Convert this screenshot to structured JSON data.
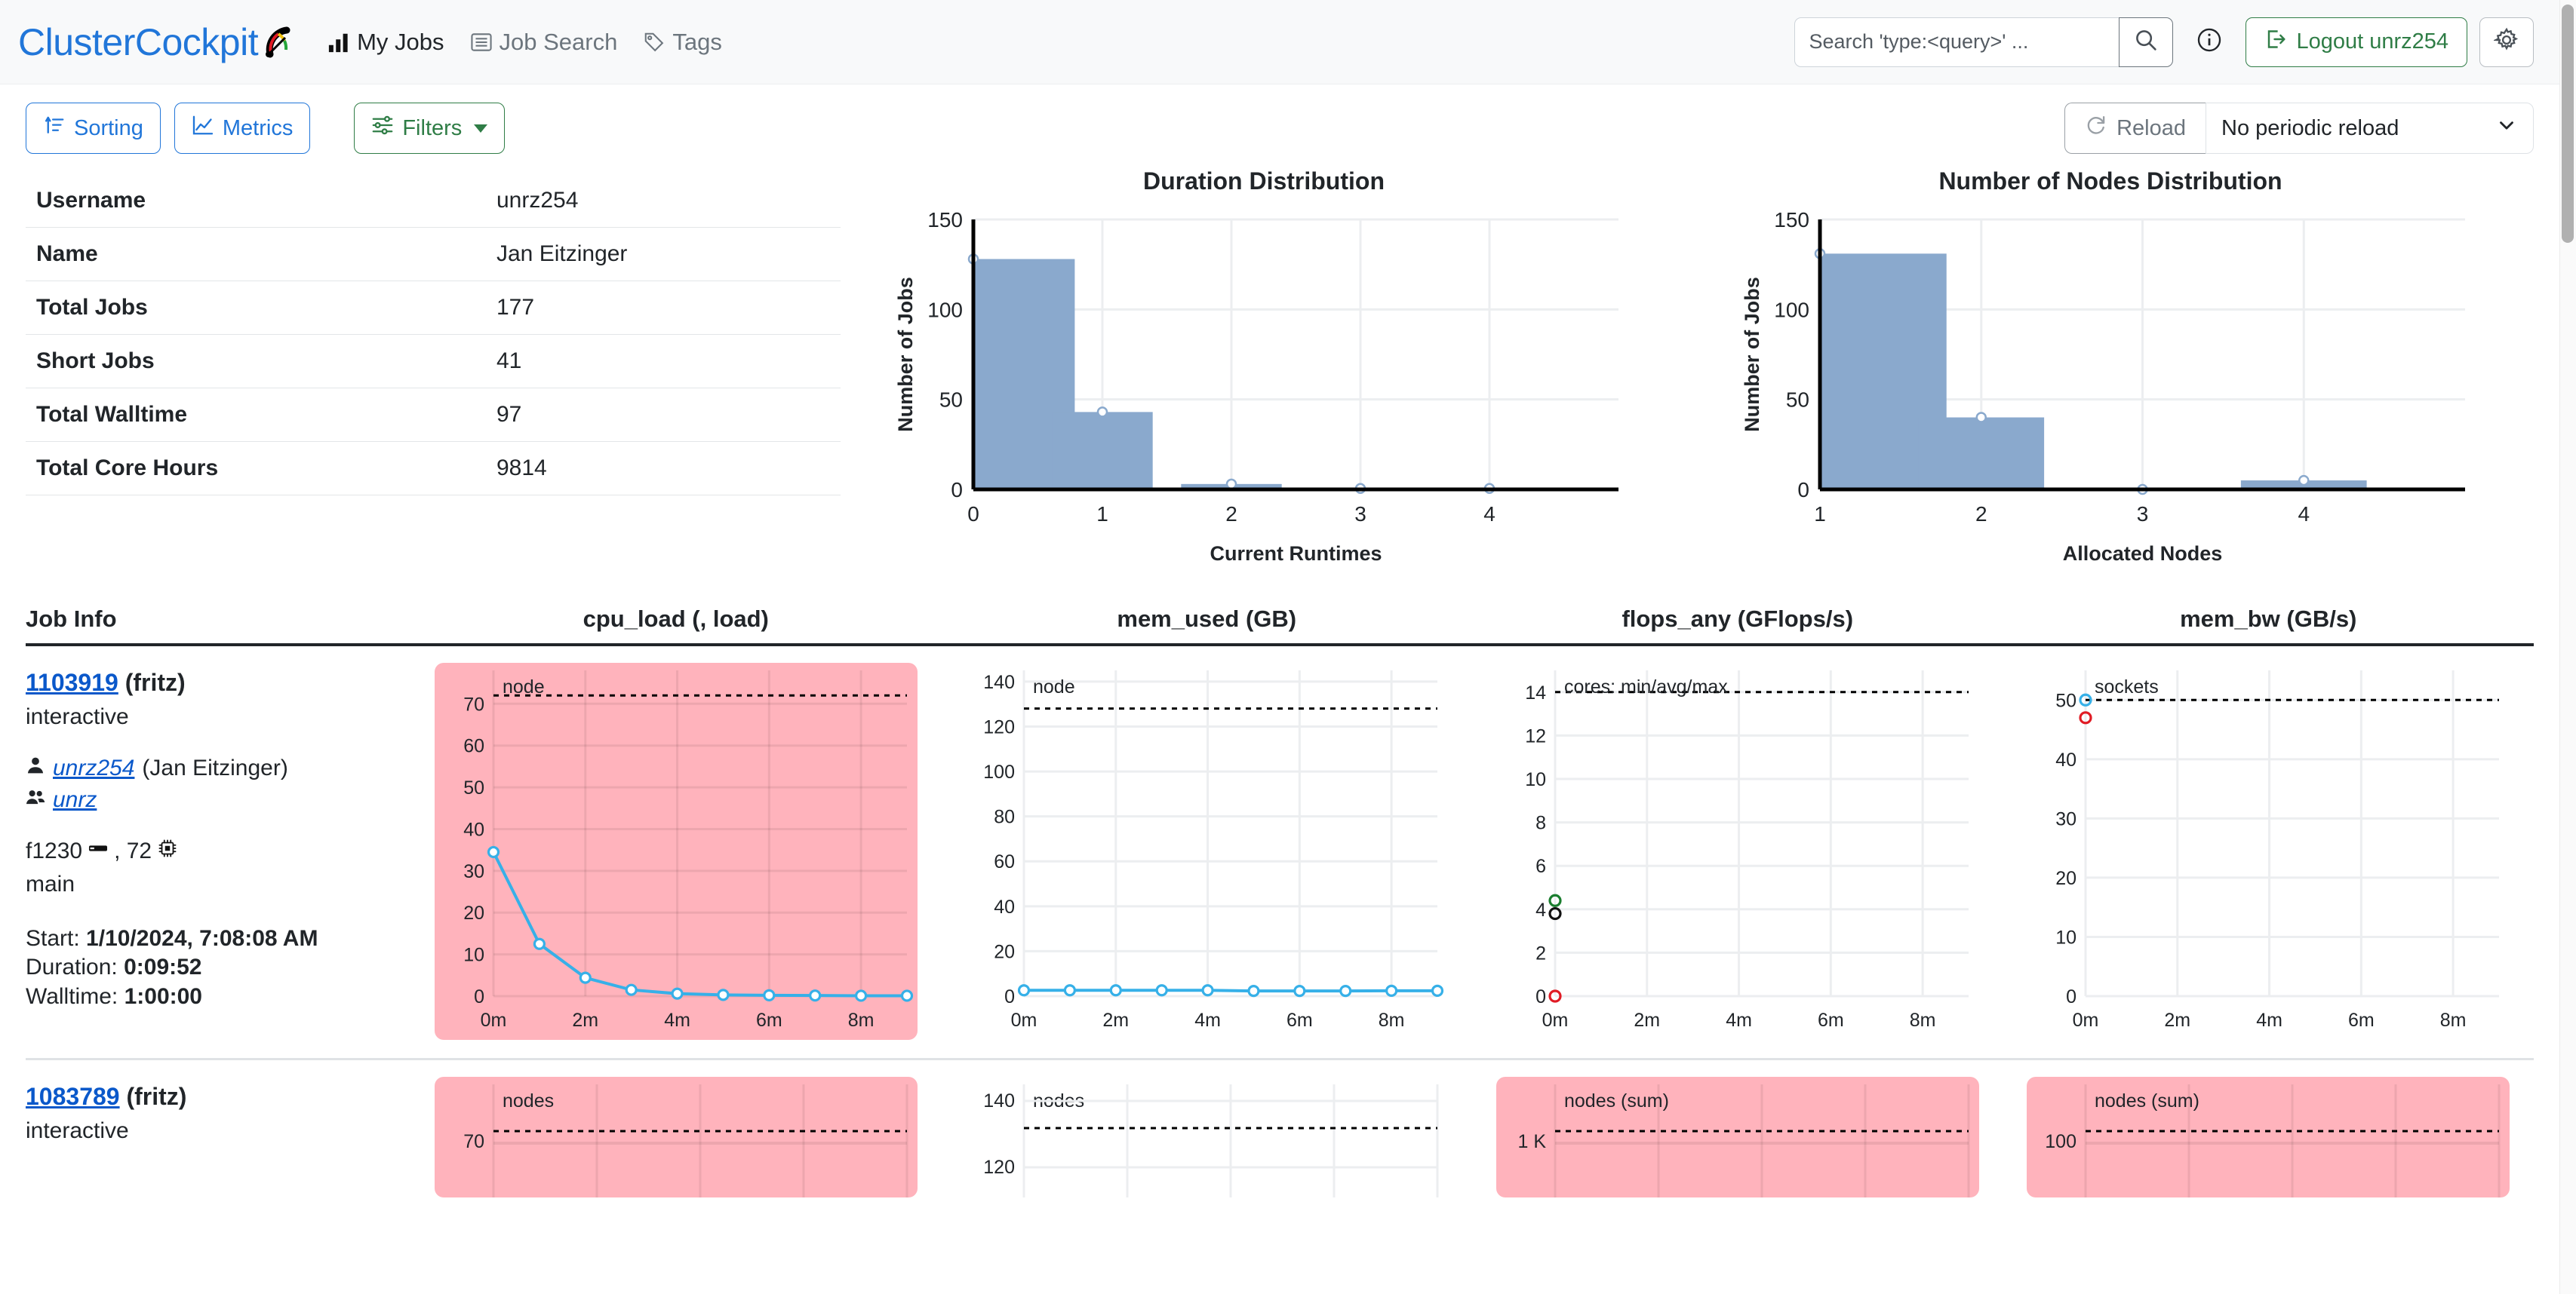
{
  "navbar": {
    "brand": "ClusterCockpit",
    "brand_icon": "gauge-icon",
    "links": [
      {
        "label": "My Jobs",
        "icon": "bar-chart-icon",
        "active": true
      },
      {
        "label": "Job Search",
        "icon": "list-icon",
        "active": false
      },
      {
        "label": "Tags",
        "icon": "tag-icon",
        "active": false
      }
    ],
    "search": {
      "placeholder": "Search 'type:<query>' ...",
      "value": ""
    },
    "search_icon": "search-icon",
    "info_icon": "info-circle-icon",
    "logout_label": "Logout unrz254",
    "logout_icon": "logout-icon",
    "settings_icon": "gear-icon",
    "accent_blue": "#2176d9",
    "accent_green": "#2f7d46"
  },
  "toolbar": {
    "sorting_label": "Sorting",
    "sorting_icon": "sort-icon",
    "metrics_label": "Metrics",
    "metrics_icon": "line-chart-icon",
    "filters_label": "Filters",
    "filters_icon": "sliders-icon",
    "reload_label": "Reload",
    "reload_icon": "refresh-icon",
    "periodic_reload_value": "No periodic reload",
    "chevron_icon": "chevron-down-icon"
  },
  "user_stats": {
    "rows": [
      {
        "key": "Username",
        "value": "unrz254"
      },
      {
        "key": "Name",
        "value": "Jan Eitzinger"
      },
      {
        "key": "Total Jobs",
        "value": "177"
      },
      {
        "key": "Short Jobs",
        "value": "41"
      },
      {
        "key": "Total Walltime",
        "value": "97"
      },
      {
        "key": "Total Core Hours",
        "value": "9814"
      }
    ]
  },
  "chart_data": [
    {
      "type": "bar",
      "title": "Duration Distribution",
      "xlabel": "Current Runtimes",
      "ylabel": "Number of Jobs",
      "categories": [
        "0",
        "1",
        "2",
        "3",
        "4"
      ],
      "values": [
        128,
        43,
        3,
        0.5,
        0.5
      ],
      "xlim": [
        0,
        4
      ],
      "ylim": [
        0,
        150
      ],
      "yticks": [
        0,
        50,
        100,
        150
      ],
      "xticks": [
        "0",
        "1",
        "2",
        "3",
        "4"
      ],
      "grid": true,
      "legend": "none",
      "bar_color": "#8aa9cd"
    },
    {
      "type": "bar",
      "title": "Number of Nodes Distribution",
      "xlabel": "Allocated Nodes",
      "ylabel": "Number of Jobs",
      "categories": [
        "1",
        "2",
        "3",
        "4"
      ],
      "values": [
        131,
        40,
        0,
        5
      ],
      "xlim": [
        1,
        4
      ],
      "ylim": [
        0,
        150
      ],
      "yticks": [
        0,
        50,
        100,
        150
      ],
      "xticks": [
        "1",
        "2",
        "3",
        "4"
      ],
      "grid": true,
      "legend": "none",
      "bar_color": "#8aa9cd"
    }
  ],
  "job_table": {
    "headers": {
      "info": "Job Info",
      "metrics": [
        "cpu_load (, load)",
        "mem_used (GB)",
        "flops_any (GFlops/s)",
        "mem_bw (GB/s)"
      ]
    },
    "rows": [
      {
        "job_id": "1103919",
        "cluster": "(fritz)",
        "partition": "interactive",
        "user": "unrz254",
        "user_full": "(Jan Eitzinger)",
        "project": "unrz",
        "node": "f1230",
        "cores": "72",
        "subcluster": "main",
        "start_label": "Start:",
        "start_value": "1/10/2024, 7:08:08 AM",
        "duration_label": "Duration:",
        "duration_value": "0:09:52",
        "walltime_label": "Walltime:",
        "walltime_value": "1:00:00",
        "user_icon": "person-icon",
        "project_icon": "people-icon",
        "node_icon": "server-icon",
        "cpu_icon": "cpu-icon",
        "metrics": [
          {
            "name": "cpu_load",
            "scope": "node",
            "warn": true,
            "ymax": 78,
            "yticks": [
              0,
              10,
              20,
              30,
              40,
              50,
              60,
              70
            ],
            "xticks": [
              "0m",
              "2m",
              "4m",
              "6m",
              "8m"
            ],
            "threshold": 72,
            "series": [
              34.5,
              12.5,
              4.4,
              1.5,
              0.6,
              0.3,
              0.2,
              0.15,
              0.1,
              0.1
            ]
          },
          {
            "name": "mem_used",
            "scope": "node",
            "warn": false,
            "ymax": 145,
            "yticks": [
              0,
              20,
              40,
              60,
              80,
              100,
              120,
              140
            ],
            "xticks": [
              "0m",
              "2m",
              "4m",
              "6m",
              "8m"
            ],
            "threshold": 128,
            "series": [
              2.6,
              2.6,
              2.6,
              2.6,
              2.6,
              2.3,
              2.3,
              2.3,
              2.4,
              2.4
            ]
          },
          {
            "name": "flops_any",
            "scope": "cores: min/avg/max",
            "warn": false,
            "ymax": 15,
            "yticks": [
              0,
              2,
              4,
              6,
              8,
              10,
              12,
              14
            ],
            "xticks": [
              "0m",
              "2m",
              "4m",
              "6m",
              "8m"
            ],
            "threshold": 14,
            "points": [
              {
                "value": 4.4,
                "color": "#1a7d2e"
              },
              {
                "value": 3.8,
                "color": "#111111"
              },
              {
                "value": 0.0,
                "color": "#e01b24"
              }
            ]
          },
          {
            "name": "mem_bw",
            "scope": "sockets",
            "warn": false,
            "ymax": 55,
            "yticks": [
              0,
              10,
              20,
              30,
              40,
              50
            ],
            "xticks": [
              "0m",
              "2m",
              "4m",
              "6m",
              "8m"
            ],
            "threshold": 50,
            "points": [
              {
                "value": 50.0,
                "color": "#36b0e8"
              },
              {
                "value": 47.0,
                "color": "#e01b24"
              }
            ]
          }
        ]
      },
      {
        "job_id": "1083789",
        "cluster": "(fritz)",
        "partition": "interactive",
        "metrics": [
          {
            "name": "cpu_load",
            "scope": "nodes",
            "warn": true,
            "tick": "70"
          },
          {
            "name": "mem_used",
            "scope": "nodes",
            "warn": false,
            "tick": "140",
            "tick2": "120"
          },
          {
            "name": "flops_any",
            "scope": "nodes (sum)",
            "warn": true,
            "tick": "1 K"
          },
          {
            "name": "mem_bw",
            "scope": "nodes (sum)",
            "warn": true,
            "tick": "100"
          }
        ]
      }
    ]
  },
  "colors": {
    "warn_bg": "#ffb3bc",
    "line_blue": "#36b0e8",
    "bar_blue": "#8aa9cd",
    "link": "#0a58ca"
  }
}
